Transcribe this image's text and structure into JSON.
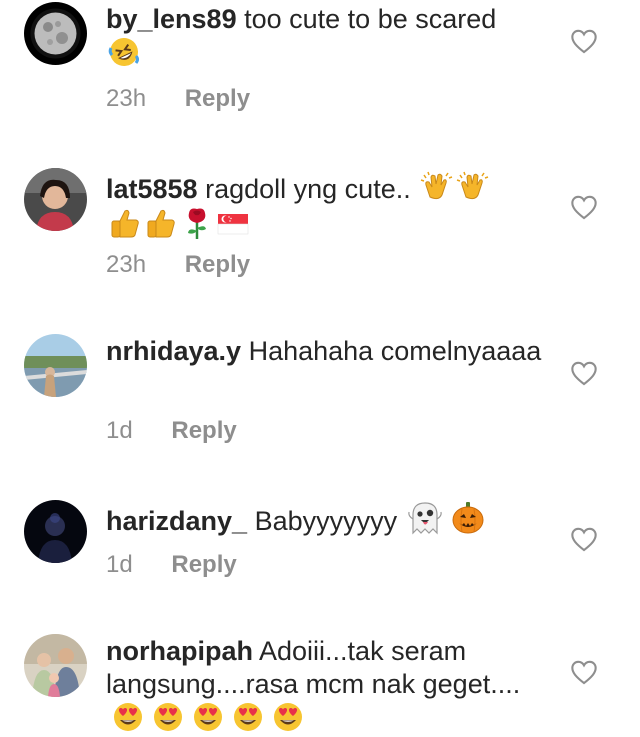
{
  "colors": {
    "text": "#262626",
    "secondary": "#8e8e8e"
  },
  "reply_label": "Reply",
  "comments": [
    {
      "username": "by_lens89",
      "text": "too cute to be scared",
      "emoji": [
        "rolling-on-floor-laughing"
      ],
      "time": "23h"
    },
    {
      "username": "lat5858",
      "text": "ragdoll yng cute..",
      "emoji": [
        "clapping-hands",
        "clapping-hands",
        "thumbs-up",
        "thumbs-up",
        "rose",
        "singapore-flag"
      ],
      "time": "23h"
    },
    {
      "username": "nrhidaya.y",
      "text": "Hahahaha comelnyaaaa",
      "emoji": [],
      "time": "1d"
    },
    {
      "username": "harizdany_",
      "text": "Babyyyyyyy",
      "emoji": [
        "ghost",
        "jack-o-lantern"
      ],
      "time": "1d"
    },
    {
      "username": "norhapipah",
      "text": "Adoiii...tak seram langsung....rasa mcm nak geget....",
      "emoji": [
        "heart-eyes",
        "heart-eyes",
        "heart-eyes",
        "heart-eyes",
        "heart-eyes"
      ],
      "time": ""
    }
  ]
}
